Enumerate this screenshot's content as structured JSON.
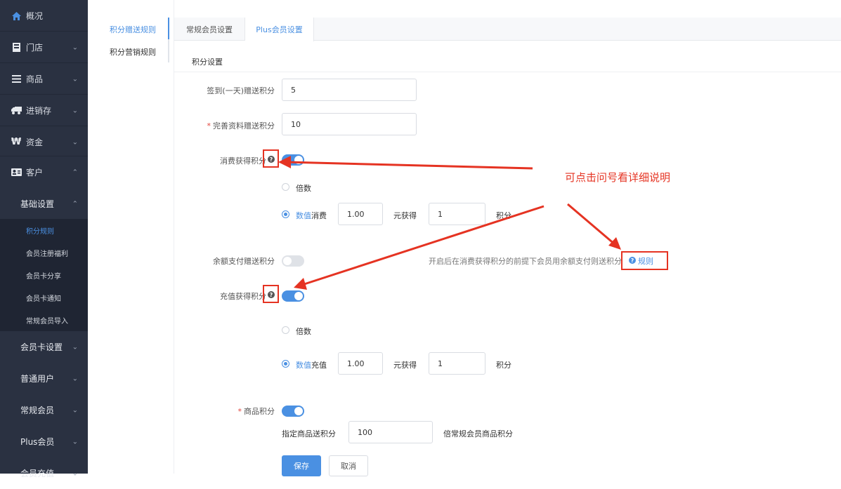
{
  "sidebar": {
    "items": [
      {
        "label": "概况",
        "icon": "home-icon"
      },
      {
        "label": "门店",
        "icon": "store-icon"
      },
      {
        "label": "商品",
        "icon": "menu-icon"
      },
      {
        "label": "进销存",
        "icon": "truck-icon"
      },
      {
        "label": "资金",
        "icon": "currency-icon"
      },
      {
        "label": "客户",
        "icon": "id-card-icon"
      }
    ],
    "sub_groups": [
      {
        "label": "基础设置"
      },
      {
        "label": "会员卡设置"
      },
      {
        "label": "普通用户"
      },
      {
        "label": "常规会员"
      },
      {
        "label": "Plus会员"
      },
      {
        "label": "会员充值"
      }
    ],
    "leaves": [
      {
        "label": "积分规则"
      },
      {
        "label": "会员注册福利"
      },
      {
        "label": "会员卡分享"
      },
      {
        "label": "会员卡通知"
      },
      {
        "label": "常规会员导入"
      }
    ]
  },
  "submenu": {
    "items": [
      {
        "label": "积分赠送规则"
      },
      {
        "label": "积分营销规则"
      }
    ]
  },
  "tabs": [
    {
      "label": "常规会员设置"
    },
    {
      "label": "Plus会员设置"
    }
  ],
  "form": {
    "section_title": "积分设置",
    "signin_label": "签到(一天)赠送积分",
    "signin_value": "5",
    "profile_label": "完善资料赠送积分",
    "profile_required": "*",
    "profile_value": "10",
    "consume_label": "消费获得积分",
    "consume_multiple": "倍数",
    "consume_value_option": "数值",
    "consume_prefix": "消费",
    "consume_amount": "1.00",
    "consume_mid": "元获得",
    "consume_points": "1",
    "consume_suffix": "积分",
    "balance_label": "余额支付赠送积分",
    "balance_hint": "开启后在消费获得积分的前提下会员用余额支付则送积分",
    "balance_rule_link": "规则",
    "recharge_label": "充值获得积分",
    "recharge_multiple": "倍数",
    "recharge_value_option": "数值",
    "recharge_prefix": "充值",
    "recharge_amount": "1.00",
    "recharge_mid": "元获得",
    "recharge_points": "1",
    "recharge_suffix": "积分",
    "goods_label": "商品积分",
    "goods_required": "*",
    "goods_specify_label": "指定商品送积分",
    "goods_value": "100",
    "goods_suffix": "倍常规会员商品积分",
    "save_label": "保存",
    "cancel_label": "取消"
  },
  "annotation": {
    "text": "可点击问号看详细说明",
    "color": "#e53322"
  },
  "colors": {
    "accent": "#4a90e2",
    "sidebar_bg": "#2a3141",
    "annotation_red": "#e53322"
  }
}
